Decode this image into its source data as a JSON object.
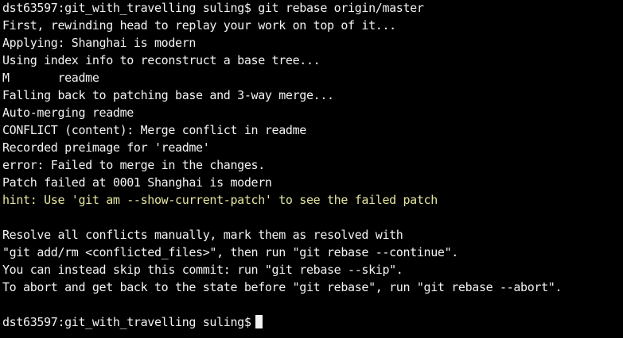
{
  "terminal": {
    "lines": [
      "dst63597:git_with_travelling suling$ git rebase origin/master",
      "First, rewinding head to replay your work on top of it...",
      "Applying: Shanghai is modern",
      "Using index info to reconstruct a base tree...",
      "M       readme",
      "Falling back to patching base and 3-way merge...",
      "Auto-merging readme",
      "CONFLICT (content): Merge conflict in readme",
      "Recorded preimage for 'readme'",
      "error: Failed to merge in the changes.",
      "Patch failed at 0001 Shanghai is modern",
      "hint: Use 'git am --show-current-patch' to see the failed patch",
      "",
      "Resolve all conflicts manually, mark them as resolved with",
      "\"git add/rm <conflicted_files>\", then run \"git rebase --continue\".",
      "You can instead skip this commit: run \"git rebase --skip\".",
      "To abort and get back to the state before \"git rebase\", run \"git rebase --abort\".",
      ""
    ],
    "prompt": "dst63597:git_with_travelling suling$",
    "colors": {
      "background": "#000000",
      "text": "#f2f2f2",
      "hint": "#e5e5a0"
    }
  }
}
